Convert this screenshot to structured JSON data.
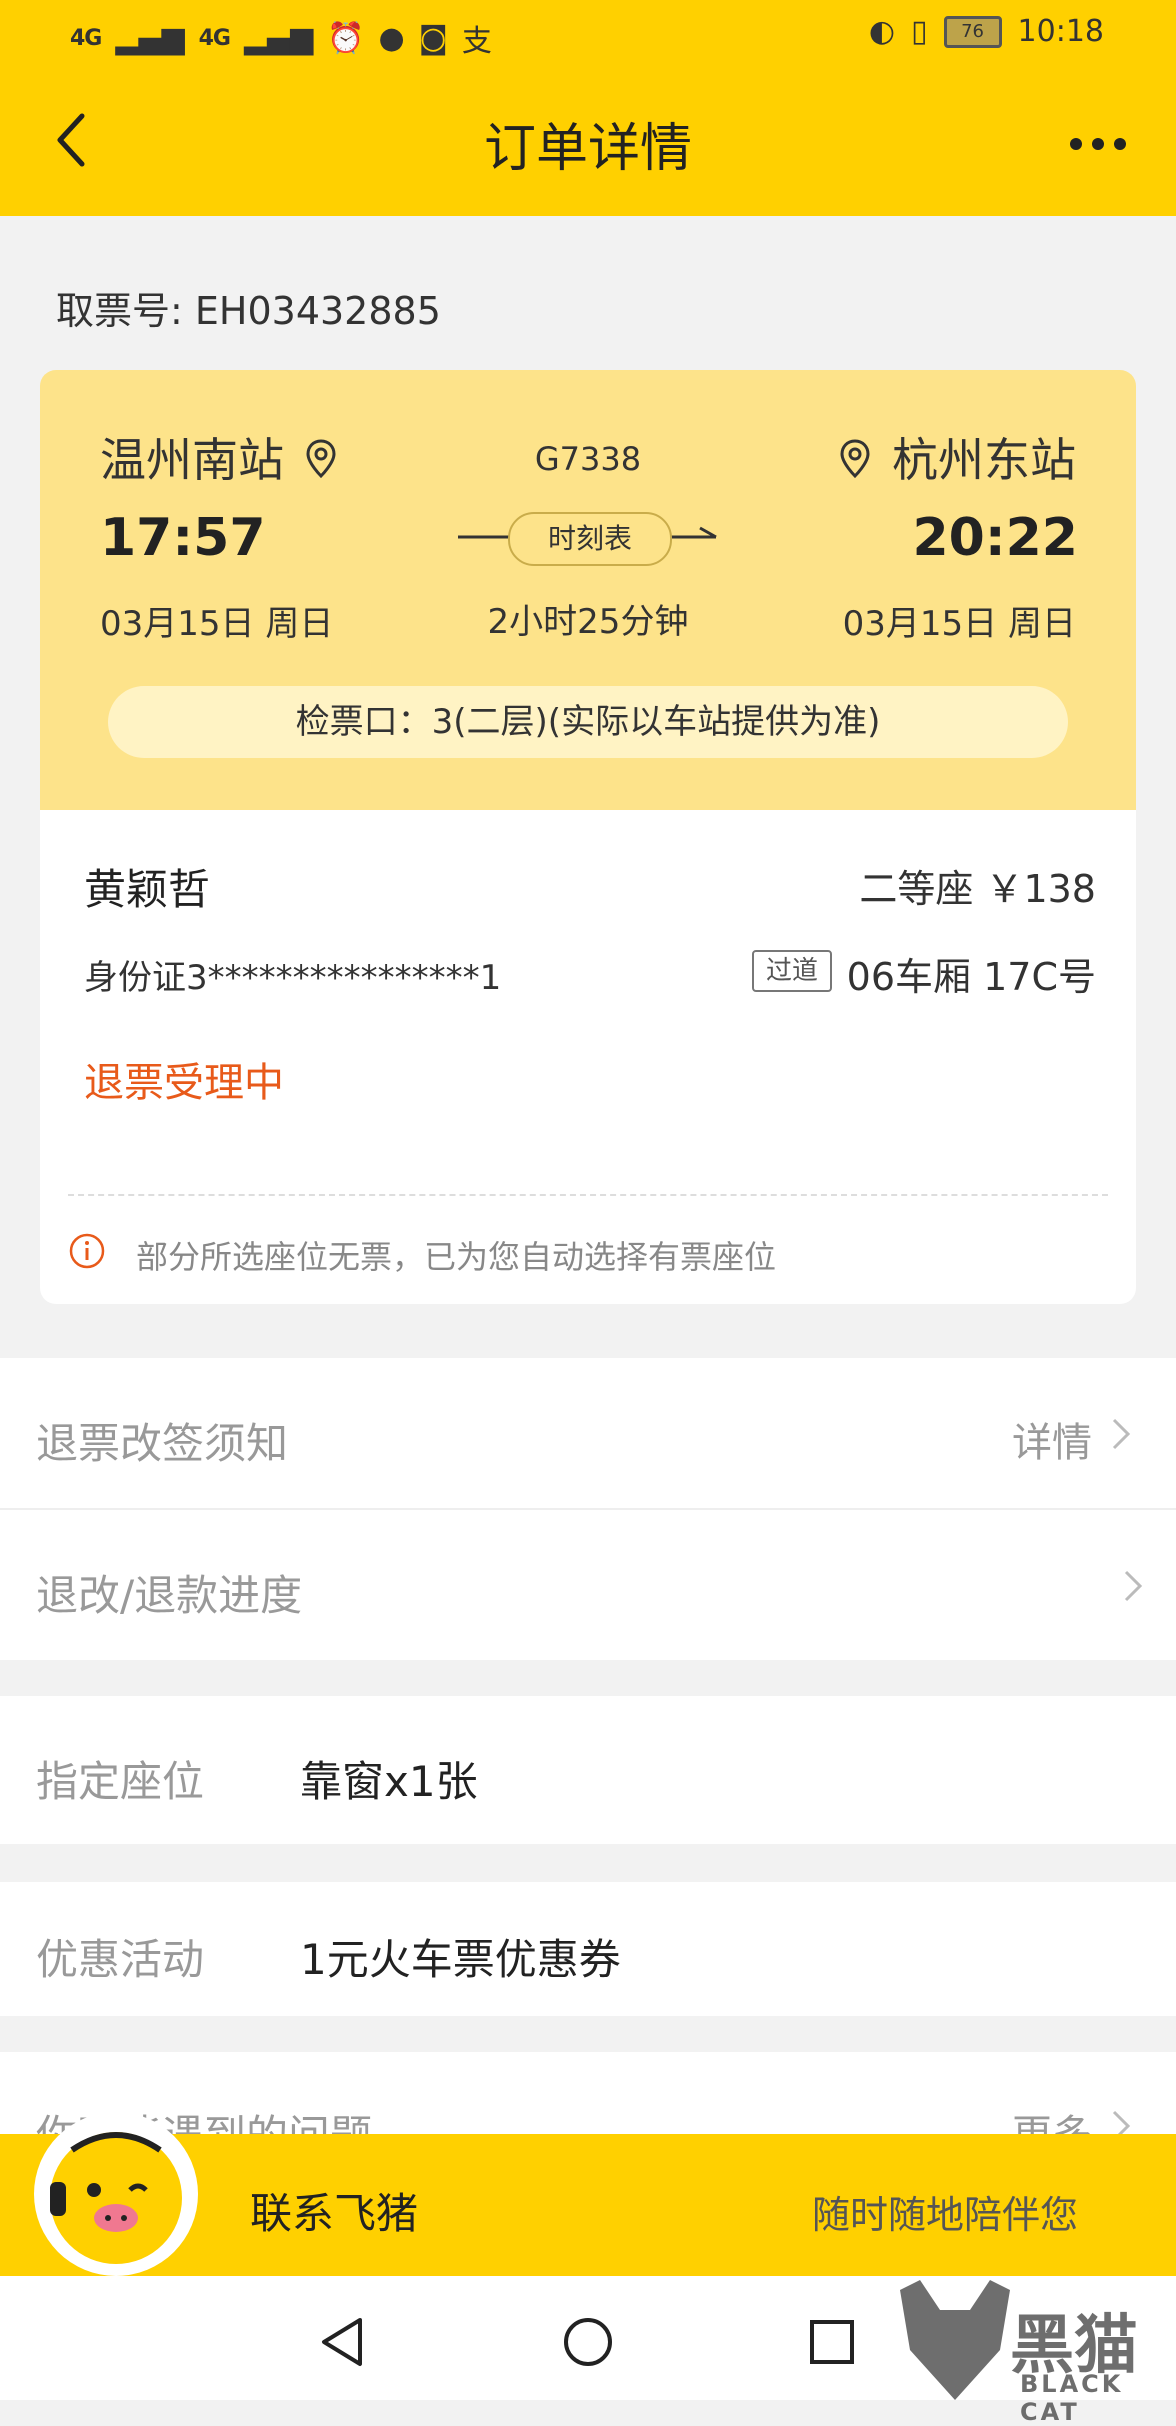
{
  "status_bar": {
    "signal1": "4G",
    "signal2": "4G",
    "battery": "76",
    "time": "10:18"
  },
  "nav": {
    "title": "订单详情"
  },
  "ticket_code": "取票号: EH03432885",
  "trip": {
    "from_station": "温州南站",
    "to_station": "杭州东站",
    "train_no": "G7338",
    "depart_time": "17:57",
    "arrive_time": "20:22",
    "schedule_label": "时刻表",
    "depart_date": "03月15日 周日",
    "arrive_date": "03月15日 周日",
    "duration": "2小时25分钟",
    "gate": "检票口：3(二层)(实际以车站提供为准)"
  },
  "passenger": {
    "name": "黄颖哲",
    "seat_class_price": "二等座  ￥138",
    "id_card": "身份证3****************1",
    "seat_tag": "过道",
    "seat_no": "06车厢 17C号",
    "status": "退票受理中",
    "notice": "部分所选座位无票，已为您自动选择有票座位"
  },
  "rows": {
    "refund_rules_label": "退票改签须知",
    "refund_rules_action": "详情",
    "refund_progress_label": "退改/退款进度",
    "seat_pref_label": "指定座位",
    "seat_pref_value": "靠窗x1张",
    "promo_label": "优惠活动",
    "promo_value": "1元火车票优惠券",
    "faq_label": "你可能遇到的问题",
    "faq_action": "更多"
  },
  "contact": {
    "title": "联系飞猪",
    "subtitle": "随时随地陪伴您"
  },
  "watermark": {
    "text": "黑猫",
    "sub": "BLACK CAT"
  },
  "colors": {
    "brand_yellow": "#ffd000",
    "card_yellow": "#fde38a",
    "status_orange": "#e85a1a"
  }
}
